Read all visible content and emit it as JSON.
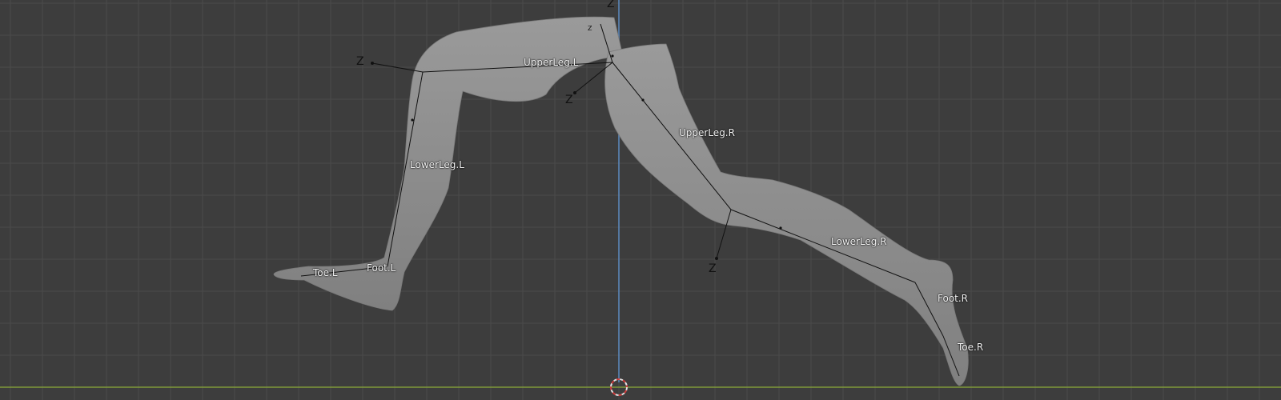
{
  "viewport": {
    "background": "#3d3d3d",
    "grid_color": "#4a4a4a",
    "z_axis_color": "#5b86b8",
    "x_axis_color": "#7f9a3a",
    "mesh_color": "#8f8f8f",
    "bone_line_color": "#1a1a1a",
    "cursor": "3d-cursor-icon"
  },
  "bones": [
    {
      "name": "UpperLeg.L"
    },
    {
      "name": "LowerLeg.L"
    },
    {
      "name": "Foot.L"
    },
    {
      "name": "Toe.L"
    },
    {
      "name": "UpperLeg.R"
    },
    {
      "name": "LowerLeg.R"
    },
    {
      "name": "Foot.R"
    },
    {
      "name": "Toe.R"
    }
  ],
  "axis_markers": [
    "Z",
    "Z",
    "Z",
    "Z",
    "Z"
  ]
}
